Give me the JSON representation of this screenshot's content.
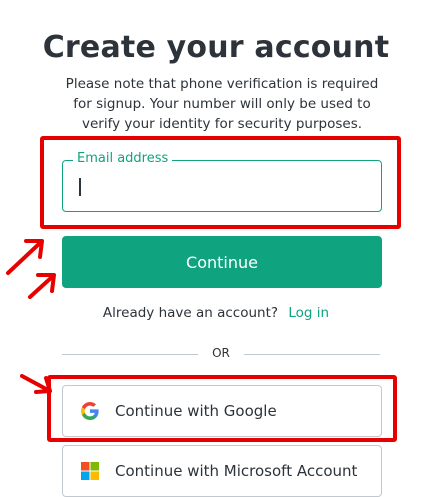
{
  "header": {
    "title": "Create your account",
    "subtitle": "Please note that phone verification is required for signup. Your number will only be used to verify your identity for security purposes."
  },
  "email": {
    "label": "Email address",
    "value": ""
  },
  "continue_button": "Continue",
  "login": {
    "prompt": "Already have an account?",
    "link": "Log in"
  },
  "divider": "OR",
  "social": {
    "google": {
      "label": "Continue with Google",
      "icon": "google-icon"
    },
    "microsoft": {
      "label": "Continue with Microsoft Account",
      "icon": "microsoft-icon"
    }
  },
  "colors": {
    "accent": "#10a37f",
    "annotation": "#e60000",
    "text": "#2d333a",
    "border": "#c2c8d0"
  }
}
